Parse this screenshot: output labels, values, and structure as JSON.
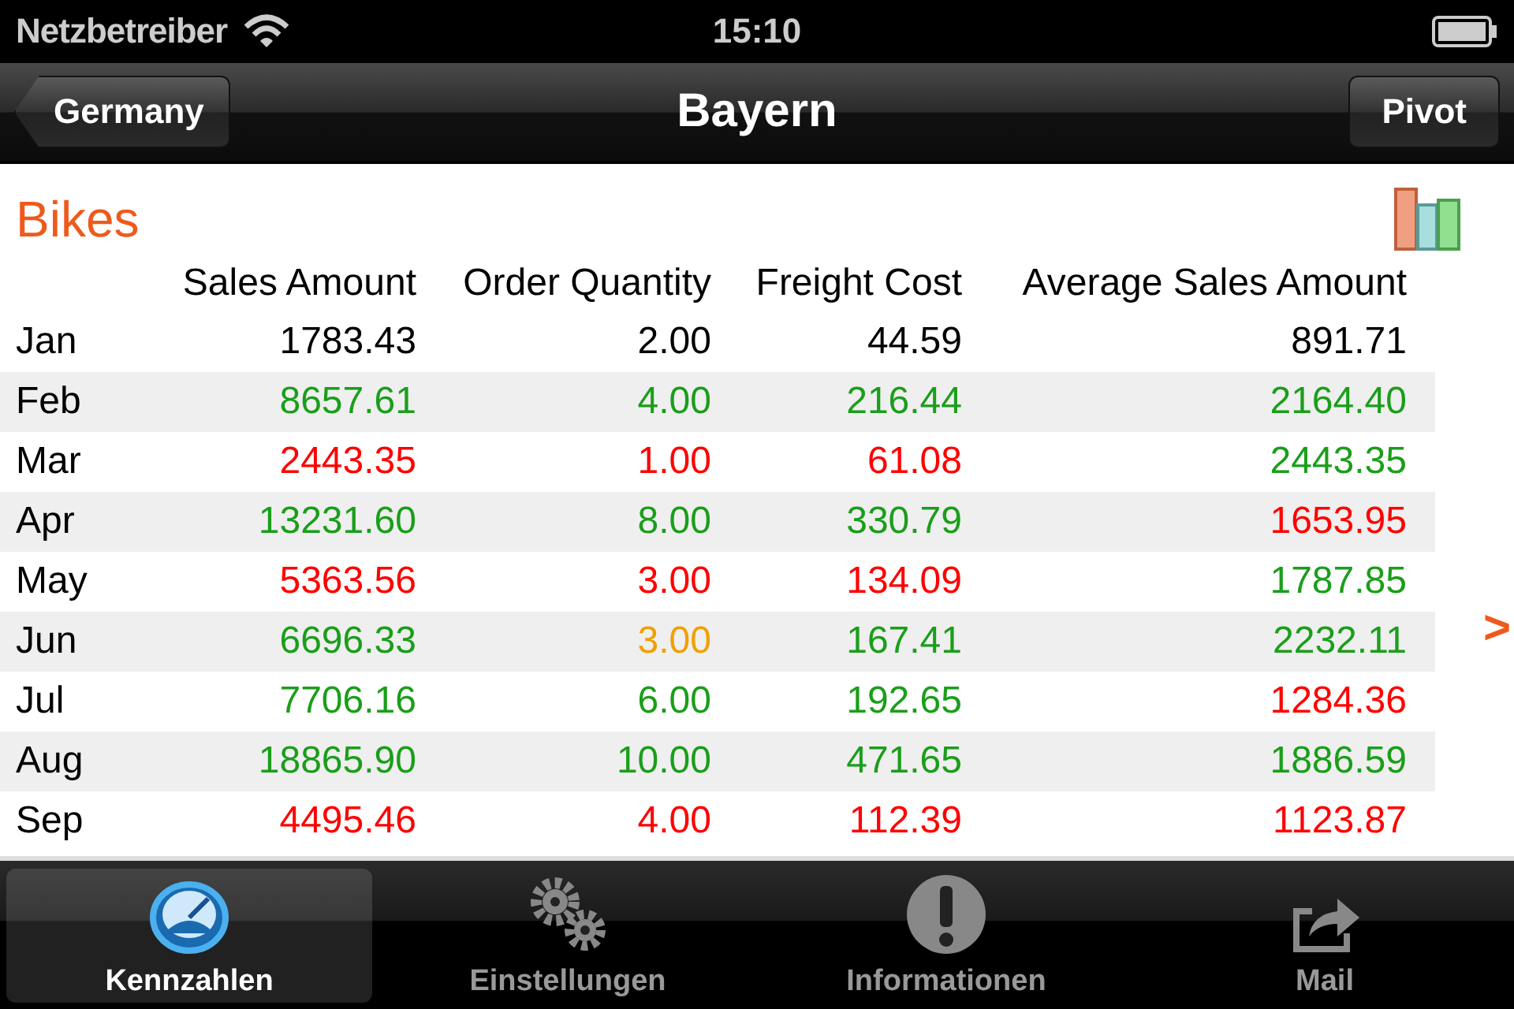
{
  "status_bar": {
    "carrier": "Netzbetreiber",
    "time": "15:10"
  },
  "nav_bar": {
    "back_button": "Germany",
    "title": "Bayern",
    "action_button": "Pivot"
  },
  "section": {
    "title": "Bikes"
  },
  "table": {
    "columns": [
      "Sales Amount",
      "Order Quantity",
      "Freight Cost",
      "Average Sales Amount"
    ],
    "rows": [
      {
        "month": "Jan",
        "cells": [
          {
            "value": "1783.43",
            "color": "#000000"
          },
          {
            "value": "2.00",
            "color": "#000000"
          },
          {
            "value": "44.59",
            "color": "#000000"
          },
          {
            "value": "891.71",
            "color": "#000000"
          }
        ]
      },
      {
        "month": "Feb",
        "cells": [
          {
            "value": "8657.61",
            "color": "#1a9e1a"
          },
          {
            "value": "4.00",
            "color": "#1a9e1a"
          },
          {
            "value": "216.44",
            "color": "#1a9e1a"
          },
          {
            "value": "2164.40",
            "color": "#1a9e1a"
          }
        ]
      },
      {
        "month": "Mar",
        "cells": [
          {
            "value": "2443.35",
            "color": "#ff0000"
          },
          {
            "value": "1.00",
            "color": "#ff0000"
          },
          {
            "value": "61.08",
            "color": "#ff0000"
          },
          {
            "value": "2443.35",
            "color": "#1a9e1a"
          }
        ]
      },
      {
        "month": "Apr",
        "cells": [
          {
            "value": "13231.60",
            "color": "#1a9e1a"
          },
          {
            "value": "8.00",
            "color": "#1a9e1a"
          },
          {
            "value": "330.79",
            "color": "#1a9e1a"
          },
          {
            "value": "1653.95",
            "color": "#ff0000"
          }
        ]
      },
      {
        "month": "May",
        "cells": [
          {
            "value": "5363.56",
            "color": "#ff0000"
          },
          {
            "value": "3.00",
            "color": "#ff0000"
          },
          {
            "value": "134.09",
            "color": "#ff0000"
          },
          {
            "value": "1787.85",
            "color": "#1a9e1a"
          }
        ]
      },
      {
        "month": "Jun",
        "cells": [
          {
            "value": "6696.33",
            "color": "#1a9e1a"
          },
          {
            "value": "3.00",
            "color": "#f0a000"
          },
          {
            "value": "167.41",
            "color": "#1a9e1a"
          },
          {
            "value": "2232.11",
            "color": "#1a9e1a"
          }
        ]
      },
      {
        "month": "Jul",
        "cells": [
          {
            "value": "7706.16",
            "color": "#1a9e1a"
          },
          {
            "value": "6.00",
            "color": "#1a9e1a"
          },
          {
            "value": "192.65",
            "color": "#1a9e1a"
          },
          {
            "value": "1284.36",
            "color": "#ff0000"
          }
        ]
      },
      {
        "month": "Aug",
        "cells": [
          {
            "value": "18865.90",
            "color": "#1a9e1a"
          },
          {
            "value": "10.00",
            "color": "#1a9e1a"
          },
          {
            "value": "471.65",
            "color": "#1a9e1a"
          },
          {
            "value": "1886.59",
            "color": "#1a9e1a"
          }
        ]
      },
      {
        "month": "Sep",
        "cells": [
          {
            "value": "4495.46",
            "color": "#ff0000"
          },
          {
            "value": "4.00",
            "color": "#ff0000"
          },
          {
            "value": "112.39",
            "color": "#ff0000"
          },
          {
            "value": "1123.87",
            "color": "#ff0000"
          }
        ]
      }
    ]
  },
  "next_arrow": ">",
  "tab_bar": [
    {
      "label": "Kennzahlen",
      "selected": true,
      "kind": "gauge"
    },
    {
      "label": "Einstellungen",
      "selected": false,
      "kind": "gears"
    },
    {
      "label": "Informationen",
      "selected": false,
      "kind": "info"
    },
    {
      "label": "Mail",
      "selected": false,
      "kind": "share"
    }
  ]
}
